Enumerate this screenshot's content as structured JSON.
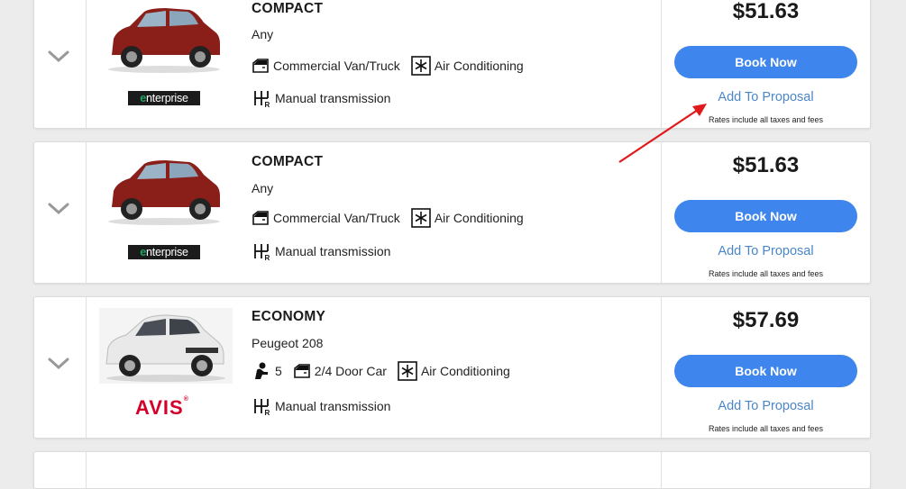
{
  "listings": [
    {
      "car_class": "COMPACT",
      "model": "Any",
      "features": [
        "Commercial Van/Truck",
        "Air Conditioning"
      ],
      "transmission": "Manual transmission",
      "vendor": "enterprise",
      "price": "$51.63",
      "book_label": "Book Now",
      "proposal_label": "Add To Proposal",
      "rates_note": "Rates include all taxes and fees",
      "car_color": "#8a1f1a"
    },
    {
      "car_class": "COMPACT",
      "model": "Any",
      "features": [
        "Commercial Van/Truck",
        "Air Conditioning"
      ],
      "transmission": "Manual transmission",
      "vendor": "enterprise",
      "price": "$51.63",
      "book_label": "Book Now",
      "proposal_label": "Add To Proposal",
      "rates_note": "Rates include all taxes and fees",
      "car_color": "#8a1f1a"
    },
    {
      "car_class": "ECONOMY",
      "model": "Peugeot 208",
      "seats": "5",
      "features": [
        "2/4 Door Car",
        "Air Conditioning"
      ],
      "transmission": "Manual transmission",
      "vendor": "AVIS",
      "price": "$57.69",
      "book_label": "Book Now",
      "proposal_label": "Add To Proposal",
      "rates_note": "Rates include all taxes and fees",
      "car_color": "#e9e9e9"
    }
  ],
  "colors": {
    "accent_button": "#3e86ee",
    "link": "#4a86c8",
    "annotation_arrow": "#e0191b",
    "avis_red": "#d4002a",
    "enterprise_green": "#1ea562"
  }
}
